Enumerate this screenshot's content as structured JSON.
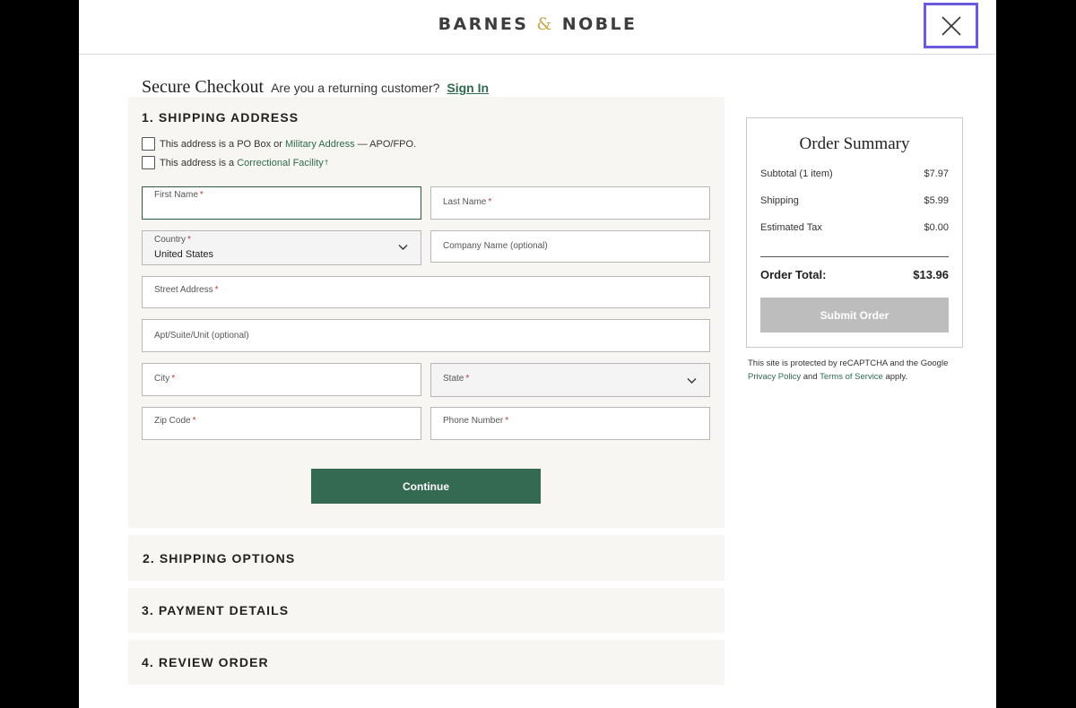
{
  "header": {
    "brand_left": "BARNES",
    "brand_amp": "&",
    "brand_right": "NOBLE",
    "close_icon": "close-x-icon"
  },
  "checkout": {
    "title": "Secure Checkout",
    "returning_prompt": "Are you a returning customer?",
    "sign_in": "Sign In"
  },
  "shipping_address": {
    "title": "1. SHIPPING ADDRESS",
    "po_box_text": "This address is a PO Box or",
    "po_box_link": "Military Address",
    "po_box_suffix": "— APO/FPO.",
    "correctional_text": "This address is a",
    "correctional_link": "Correctional Facility",
    "correctional_mark": "†",
    "required_mark": "*",
    "fields": {
      "first_name": "First Name",
      "last_name": "Last Name",
      "country_label": "Country",
      "country_value": "United States",
      "company": "Company Name (optional)",
      "street": "Street Address",
      "apt": "Apt/Suite/Unit (optional)",
      "city": "City",
      "state": "State",
      "zip": "Zip Code",
      "phone": "Phone Number"
    },
    "continue_label": "Continue"
  },
  "sections": {
    "shipping_options": "2. SHIPPING OPTIONS",
    "payment_details": "3. PAYMENT DETAILS",
    "review_order": "4. REVIEW ORDER"
  },
  "summary": {
    "title": "Order Summary",
    "subtotal_label": "Subtotal (1 item)",
    "subtotal_value": "$7.97",
    "shipping_label": "Shipping",
    "shipping_value": "$5.99",
    "tax_label": "Estimated Tax",
    "tax_value": "$0.00",
    "total_label": "Order Total:",
    "total_value": "$13.96",
    "submit_label": "Submit Order"
  },
  "recaptcha": {
    "line1": "This site is protected by reCAPTCHA and the Google",
    "privacy": "Privacy Policy",
    "and": "and",
    "terms": "Terms of Service",
    "apply": "apply."
  },
  "colors": {
    "brand_green": "#346a51",
    "link_green": "#2f6a4f",
    "gold": "#c9a74a",
    "focus_outline": "#6b5bdc",
    "required": "#c0392b"
  }
}
